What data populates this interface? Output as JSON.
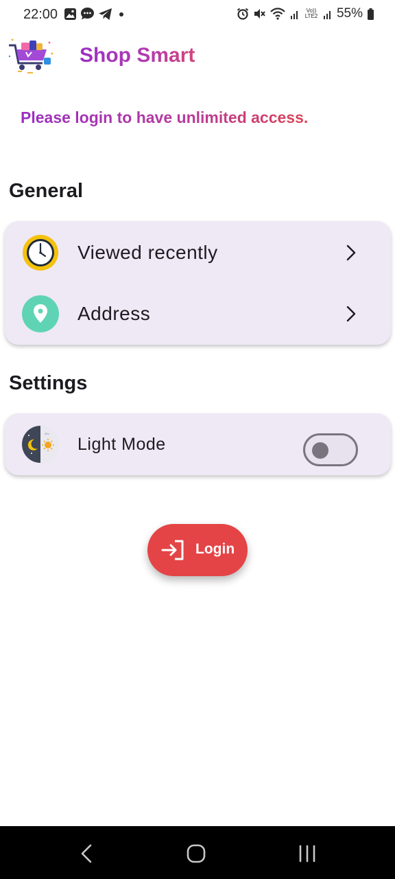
{
  "status_bar": {
    "time": "22:00",
    "left_icons": [
      "gallery-icon",
      "chat-bubble-icon",
      "telegram-icon",
      "dot-icon"
    ],
    "right_icons": [
      "alarm-icon",
      "mute-icon",
      "wifi-icon",
      "signal-icon",
      "volte-icon",
      "signal-icon",
      "battery-icon"
    ],
    "volte_label": "Vo)) LTE2",
    "battery": "55%"
  },
  "app": {
    "title": "Shop Smart",
    "logo": "shopping-cart-logo"
  },
  "login_prompt": "Please login to have unlimited access.",
  "general": {
    "heading": "General",
    "items": [
      {
        "label": "Viewed recently",
        "icon": "clock-icon"
      },
      {
        "label": "Address",
        "icon": "location-pin-icon"
      }
    ]
  },
  "settings": {
    "heading": "Settings",
    "items": [
      {
        "label": "Light Mode",
        "icon": "day-night-icon",
        "toggle_on": false
      }
    ]
  },
  "login_button": {
    "label": "Login",
    "icon": "login-arrow-icon"
  },
  "nav_bar": {
    "buttons": [
      "back-icon",
      "home-icon",
      "recent-apps-icon"
    ]
  },
  "colors": {
    "title_gradient": [
      "#9c2fc4",
      "#d2457a"
    ],
    "card_background": "#efe8f5",
    "login_button": "#e44446",
    "clock_ring": "#f4c20d",
    "pin_circle": "#5fd4b4"
  }
}
